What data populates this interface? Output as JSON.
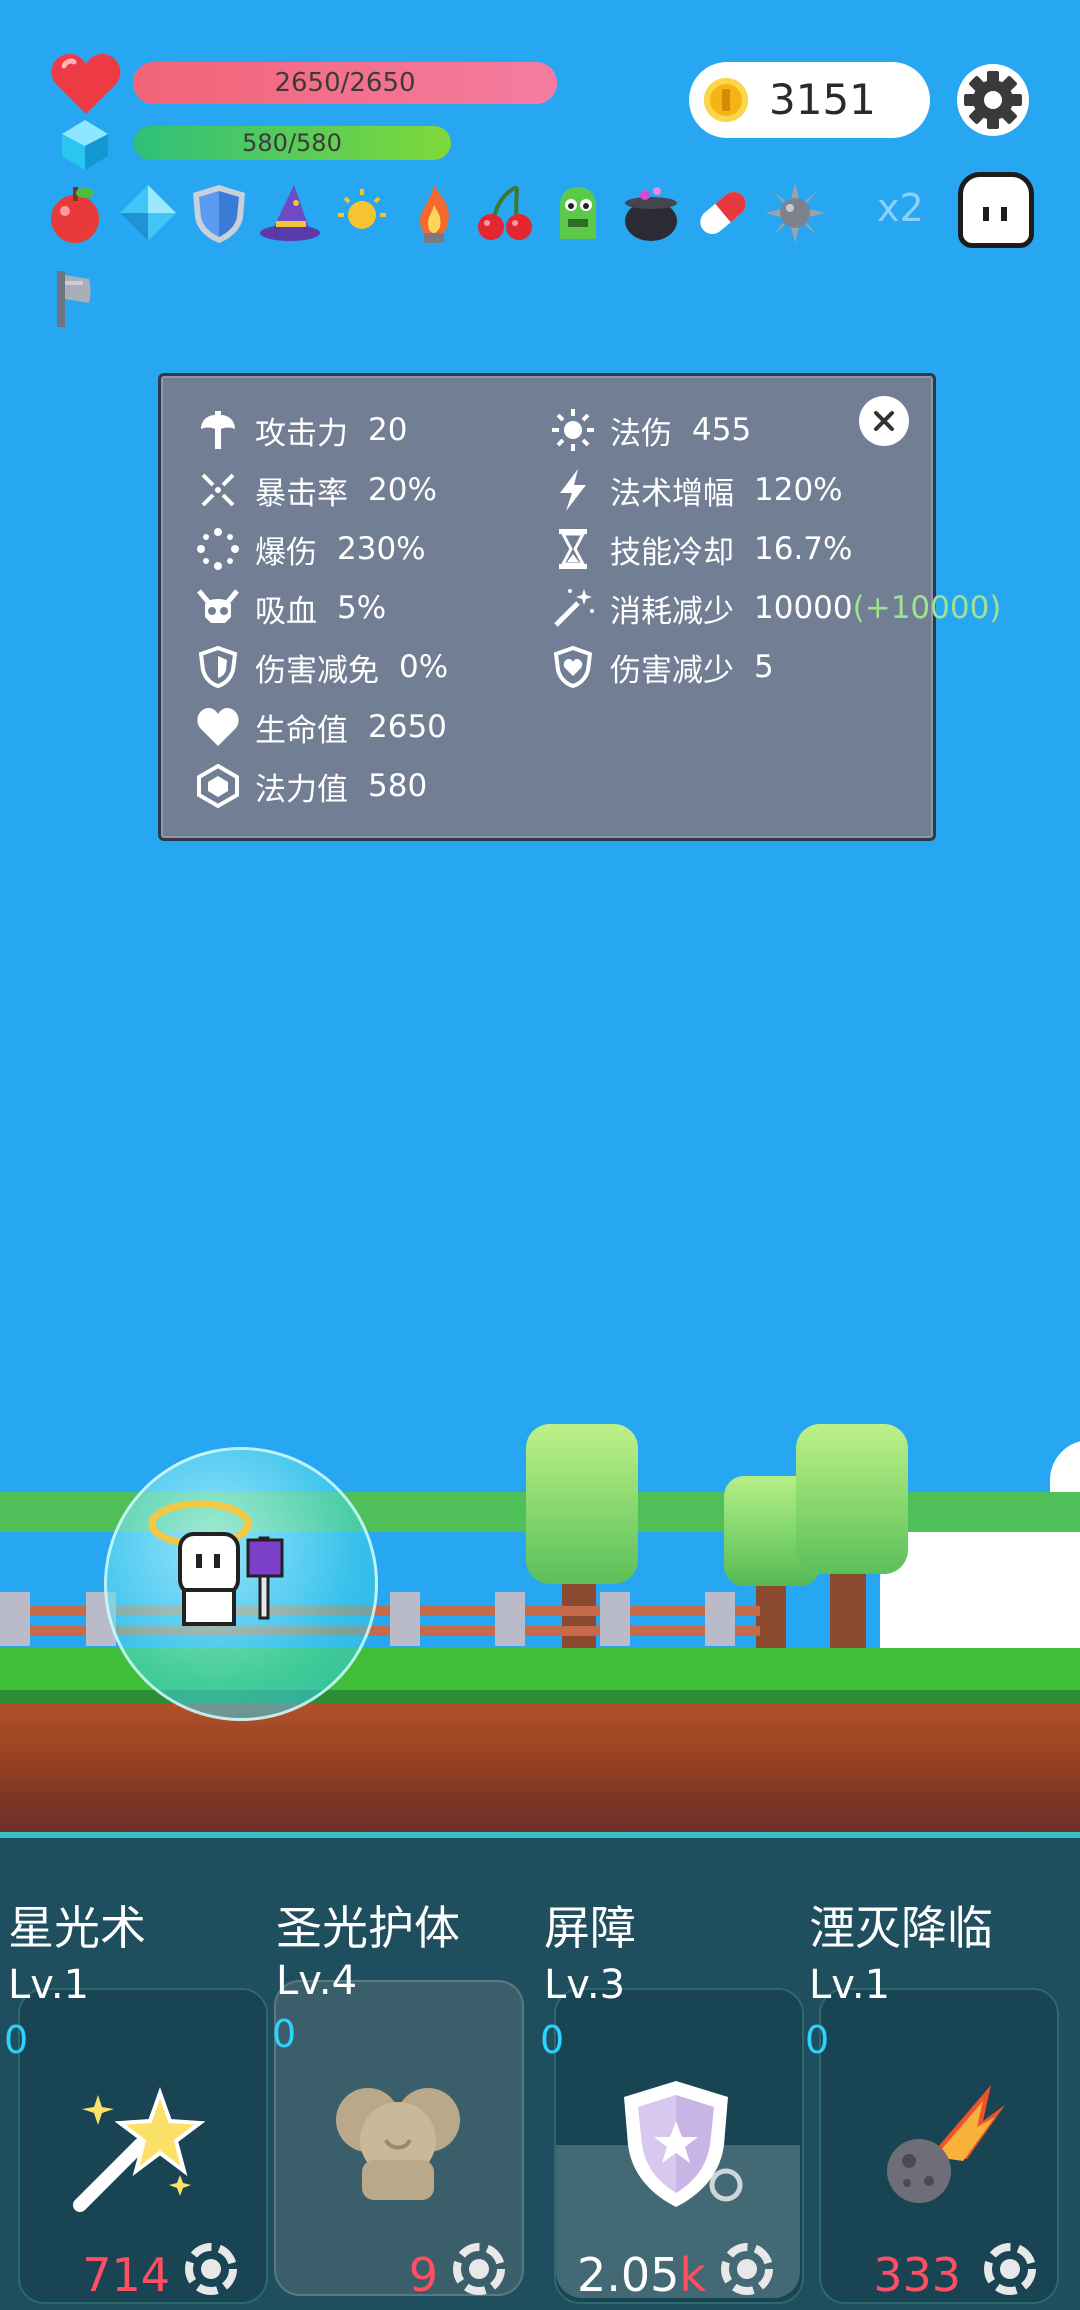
{
  "hud": {
    "hp_text": "2650/2650",
    "hp_fraction": 1.0,
    "mp_text": "580/580",
    "mp_fraction": 1.0,
    "coins": "3151",
    "buff_multiplier": "x2"
  },
  "buff_icons": [
    "apple-icon",
    "diamond-icon",
    "shield-icon",
    "wizard-hat-icon",
    "sun-icon",
    "flame-icon",
    "cherry-icon",
    "green-monster-icon",
    "cauldron-icon",
    "pill-icon",
    "spiked-ball-icon",
    "axe-icon"
  ],
  "stats": {
    "left": [
      {
        "label": "攻击力",
        "value": "20",
        "icon": "axe-icon"
      },
      {
        "label": "暴击率",
        "value": "20%",
        "icon": "crit-cross-icon"
      },
      {
        "label": "爆伤",
        "value": "230%",
        "icon": "burst-ring-icon"
      },
      {
        "label": "吸血",
        "value": "5%",
        "icon": "horned-skull-icon"
      },
      {
        "label": "伤害减免",
        "value": "0%",
        "icon": "shield-outline-icon"
      },
      {
        "label": "生命值",
        "value": "2650",
        "icon": "heart-icon"
      },
      {
        "label": "法力值",
        "value": "580",
        "icon": "gem-icon"
      }
    ],
    "right": [
      {
        "label": "法伤",
        "value": "455",
        "icon": "sun-burst-icon"
      },
      {
        "label": "法术增幅",
        "value": "120%",
        "icon": "lightning-icon"
      },
      {
        "label": "技能冷却",
        "value": "16.7%",
        "icon": "hourglass-icon"
      },
      {
        "label": "消耗减少",
        "value": "10000",
        "bonus": "(+10000)",
        "icon": "magic-wand-icon"
      },
      {
        "label": "伤害减少",
        "value": "5",
        "icon": "heart-shield-icon"
      }
    ]
  },
  "skills": [
    {
      "name": "星光术",
      "level": "Lv.1",
      "count": "0",
      "cost": "714",
      "cost_unit": "",
      "icon": "star-wand-icon"
    },
    {
      "name": "圣光护体",
      "level": "Lv.4",
      "count": "0",
      "cost": "9",
      "cost_unit": "",
      "icon": "holy-guard-icon"
    },
    {
      "name": "屏障",
      "level": "Lv.3",
      "count": "0",
      "cost": "2.05",
      "cost_unit": "k",
      "icon": "barrier-shield-icon"
    },
    {
      "name": "湮灭降临",
      "level": "Lv.1",
      "count": "0",
      "cost": "333",
      "cost_unit": "",
      "icon": "meteor-icon"
    }
  ],
  "colors": {
    "sky": "#27a6f2",
    "hp": "#f26476",
    "mp": "#2fbf7a",
    "panel": "#727e94",
    "cost": "#ff4f62",
    "bonus": "#9ee38f",
    "count": "#2fd1ff"
  }
}
